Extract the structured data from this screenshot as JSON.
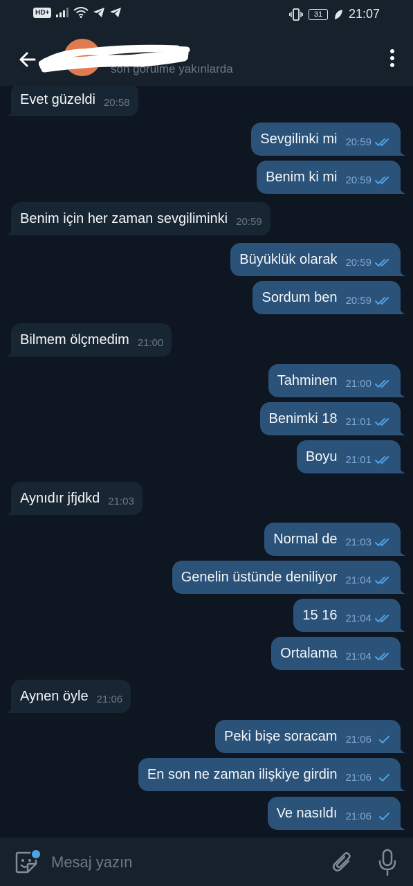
{
  "status_bar": {
    "badge": "HD+",
    "time": "21:07",
    "battery": "31",
    "icons": [
      "signal-icon",
      "wifi-icon",
      "telegram-notification-icon",
      "vibrate-icon",
      "battery-icon",
      "leaf-icon"
    ]
  },
  "header": {
    "last_seen": "son görülme yakınlarda",
    "back_icon": "arrow-left-icon",
    "menu_icon": "more-vertical-icon"
  },
  "messages": [
    {
      "dir": "in",
      "text": "Evet güzeldi",
      "time": "20:58"
    },
    {
      "dir": "out",
      "text": "Sevgilinki mi",
      "time": "20:59",
      "read": true
    },
    {
      "dir": "out",
      "text": "Benim ki mi",
      "time": "20:59",
      "read": true
    },
    {
      "dir": "in",
      "text": "Benim için her zaman sevgiliminki",
      "time": "20:59"
    },
    {
      "dir": "out",
      "text": "Büyüklük olarak",
      "time": "20:59",
      "read": true
    },
    {
      "dir": "out",
      "text": "Sordum ben",
      "time": "20:59",
      "read": true
    },
    {
      "dir": "in",
      "text": "Bilmem ölçmedim",
      "time": "21:00"
    },
    {
      "dir": "out",
      "text": "Tahminen",
      "time": "21:00",
      "read": true
    },
    {
      "dir": "out",
      "text": "Benimki 18",
      "time": "21:01",
      "read": true
    },
    {
      "dir": "out",
      "text": "Boyu",
      "time": "21:01",
      "read": true
    },
    {
      "dir": "in",
      "text": "Aynıdır jfjdkd",
      "time": "21:03"
    },
    {
      "dir": "out",
      "text": "Normal de",
      "time": "21:03",
      "read": true
    },
    {
      "dir": "out",
      "text": "Genelin üstünde deniliyor",
      "time": "21:04",
      "read": true
    },
    {
      "dir": "out",
      "text": "15 16",
      "time": "21:04",
      "read": true
    },
    {
      "dir": "out",
      "text": "Ortalama",
      "time": "21:04",
      "read": true
    },
    {
      "dir": "in",
      "text": "Aynen öyle",
      "time": "21:06"
    },
    {
      "dir": "out",
      "text": "Peki bişe soracam",
      "time": "21:06",
      "read": false
    },
    {
      "dir": "out",
      "text": "En son ne zaman ilişkiye girdin",
      "time": "21:06",
      "read": false
    },
    {
      "dir": "out",
      "text": "Ve nasıldı",
      "time": "21:06",
      "read": false
    }
  ],
  "composer": {
    "placeholder": "Mesaj yazın",
    "icons": [
      "sticker-icon",
      "paperclip-icon",
      "microphone-icon"
    ]
  },
  "colors": {
    "background": "#0e1621",
    "header": "#17212b",
    "incoming_bubble": "#182533",
    "outgoing_bubble": "#2b5278",
    "tick": "#4fa3e7"
  }
}
